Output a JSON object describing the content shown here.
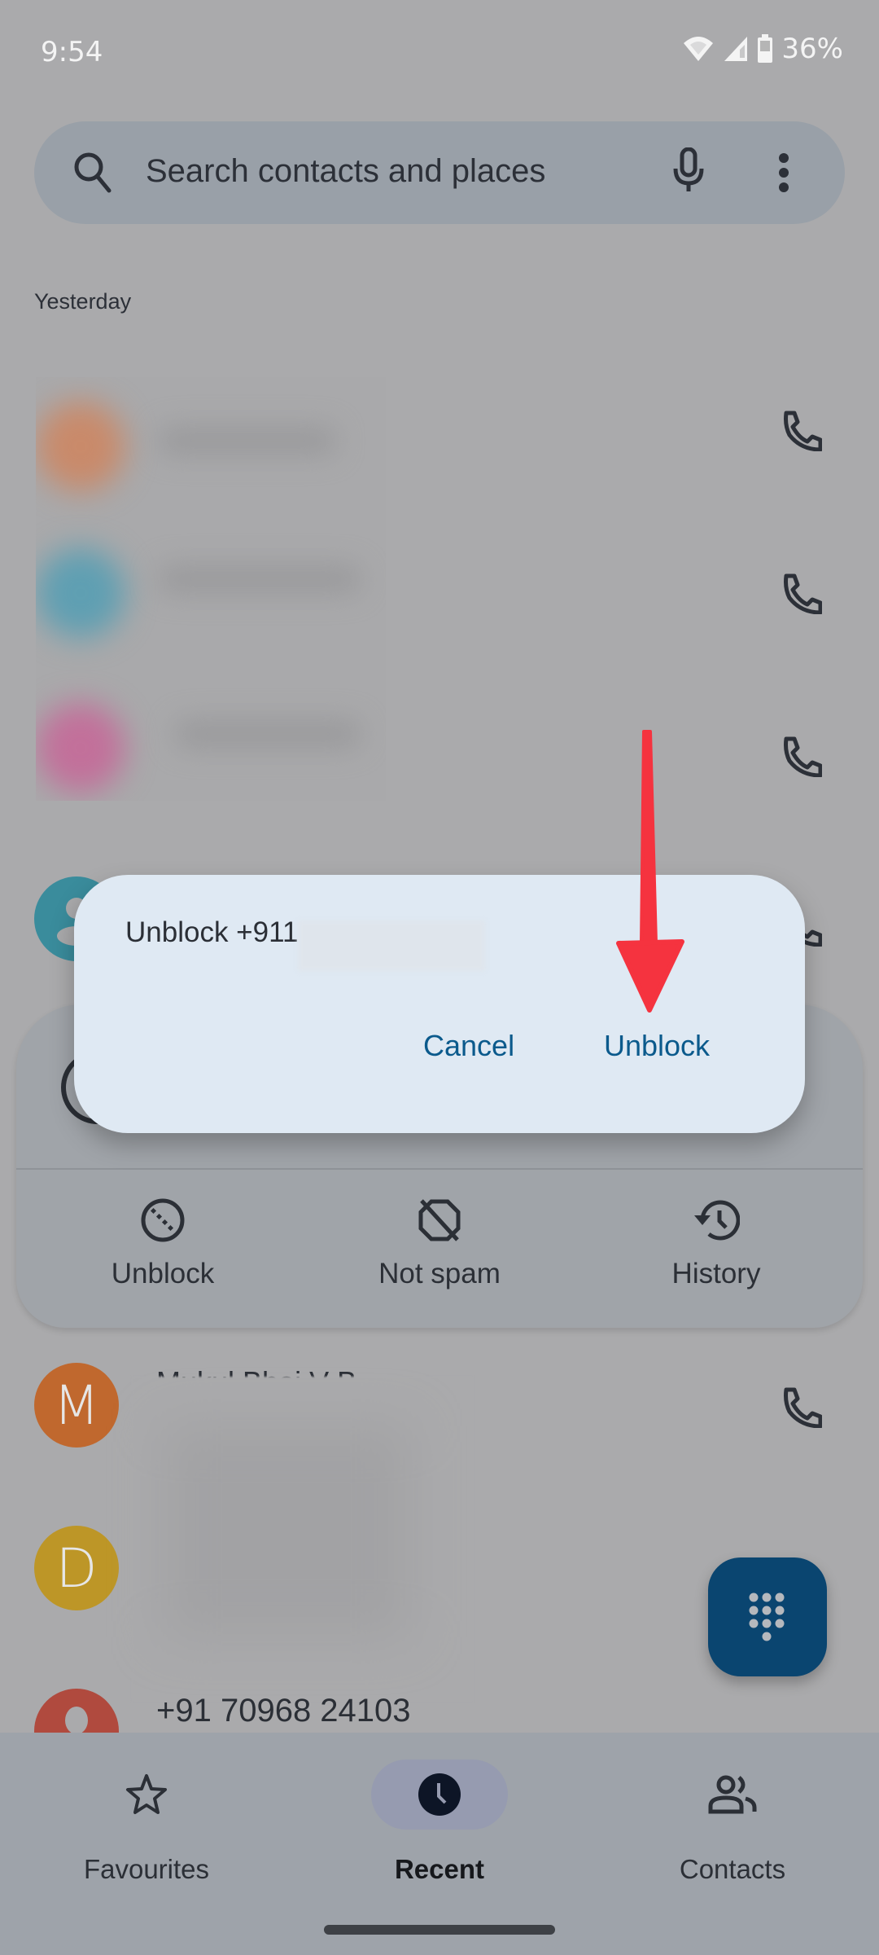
{
  "status_bar": {
    "time": "9:54",
    "battery_percent": "36%",
    "icons": [
      "wifi-icon",
      "signal-icon",
      "battery-icon"
    ]
  },
  "search": {
    "placeholder": "Search contacts and places",
    "icons": [
      "search-icon",
      "mic-icon",
      "more-vert-icon"
    ]
  },
  "call_log": {
    "section_header": "Yesterday",
    "rows_blurred_count": 3,
    "partial_contact_name": "Mukul Bhai V B",
    "avatar_letters": [
      "M",
      "D"
    ],
    "visible_number": "+91 70968 24103"
  },
  "bottom_sheet": {
    "actions": [
      {
        "label": "Unblock",
        "icon": "unblock-icon"
      },
      {
        "label": "Not spam",
        "icon": "not-spam-icon"
      },
      {
        "label": "History",
        "icon": "history-icon"
      }
    ]
  },
  "dialog": {
    "title": "Unblock +911",
    "cancel_label": "Cancel",
    "confirm_label": "Unblock"
  },
  "fab": {
    "icon": "dialpad-icon"
  },
  "nav": {
    "items": [
      {
        "label": "Favourites",
        "icon": "star-icon",
        "active": false
      },
      {
        "label": "Recent",
        "icon": "clock-icon",
        "active": true
      },
      {
        "label": "Contacts",
        "icon": "contacts-icon",
        "active": false
      }
    ]
  },
  "colors": {
    "accent": "#0b5a8c",
    "fab": "#0a4570",
    "annotation_arrow": "#f5333f",
    "dialog_bg": "#dfe9f3"
  }
}
